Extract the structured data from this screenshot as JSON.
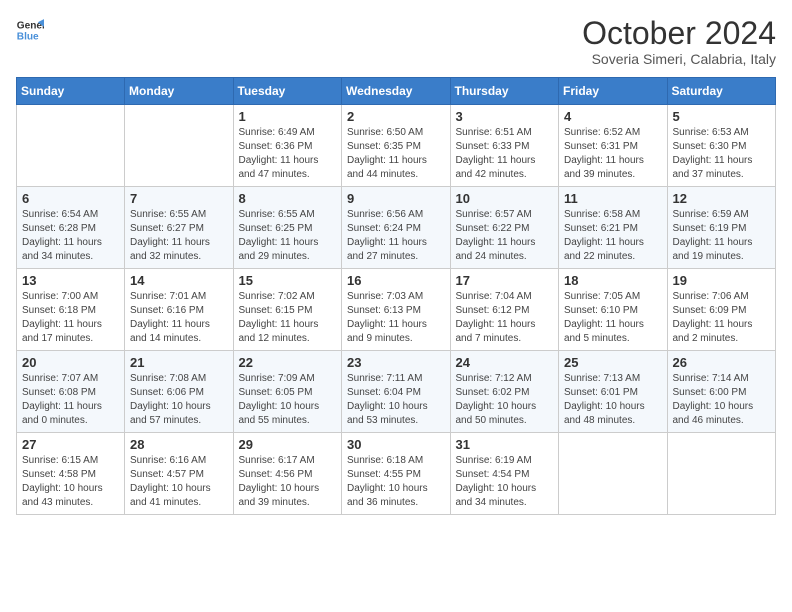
{
  "logo": {
    "line1": "General",
    "line2": "Blue"
  },
  "title": "October 2024",
  "location": "Soveria Simeri, Calabria, Italy",
  "days_header": [
    "Sunday",
    "Monday",
    "Tuesday",
    "Wednesday",
    "Thursday",
    "Friday",
    "Saturday"
  ],
  "weeks": [
    [
      {
        "day": "",
        "detail": ""
      },
      {
        "day": "",
        "detail": ""
      },
      {
        "day": "1",
        "detail": "Sunrise: 6:49 AM\nSunset: 6:36 PM\nDaylight: 11 hours and 47 minutes."
      },
      {
        "day": "2",
        "detail": "Sunrise: 6:50 AM\nSunset: 6:35 PM\nDaylight: 11 hours and 44 minutes."
      },
      {
        "day": "3",
        "detail": "Sunrise: 6:51 AM\nSunset: 6:33 PM\nDaylight: 11 hours and 42 minutes."
      },
      {
        "day": "4",
        "detail": "Sunrise: 6:52 AM\nSunset: 6:31 PM\nDaylight: 11 hours and 39 minutes."
      },
      {
        "day": "5",
        "detail": "Sunrise: 6:53 AM\nSunset: 6:30 PM\nDaylight: 11 hours and 37 minutes."
      }
    ],
    [
      {
        "day": "6",
        "detail": "Sunrise: 6:54 AM\nSunset: 6:28 PM\nDaylight: 11 hours and 34 minutes."
      },
      {
        "day": "7",
        "detail": "Sunrise: 6:55 AM\nSunset: 6:27 PM\nDaylight: 11 hours and 32 minutes."
      },
      {
        "day": "8",
        "detail": "Sunrise: 6:55 AM\nSunset: 6:25 PM\nDaylight: 11 hours and 29 minutes."
      },
      {
        "day": "9",
        "detail": "Sunrise: 6:56 AM\nSunset: 6:24 PM\nDaylight: 11 hours and 27 minutes."
      },
      {
        "day": "10",
        "detail": "Sunrise: 6:57 AM\nSunset: 6:22 PM\nDaylight: 11 hours and 24 minutes."
      },
      {
        "day": "11",
        "detail": "Sunrise: 6:58 AM\nSunset: 6:21 PM\nDaylight: 11 hours and 22 minutes."
      },
      {
        "day": "12",
        "detail": "Sunrise: 6:59 AM\nSunset: 6:19 PM\nDaylight: 11 hours and 19 minutes."
      }
    ],
    [
      {
        "day": "13",
        "detail": "Sunrise: 7:00 AM\nSunset: 6:18 PM\nDaylight: 11 hours and 17 minutes."
      },
      {
        "day": "14",
        "detail": "Sunrise: 7:01 AM\nSunset: 6:16 PM\nDaylight: 11 hours and 14 minutes."
      },
      {
        "day": "15",
        "detail": "Sunrise: 7:02 AM\nSunset: 6:15 PM\nDaylight: 11 hours and 12 minutes."
      },
      {
        "day": "16",
        "detail": "Sunrise: 7:03 AM\nSunset: 6:13 PM\nDaylight: 11 hours and 9 minutes."
      },
      {
        "day": "17",
        "detail": "Sunrise: 7:04 AM\nSunset: 6:12 PM\nDaylight: 11 hours and 7 minutes."
      },
      {
        "day": "18",
        "detail": "Sunrise: 7:05 AM\nSunset: 6:10 PM\nDaylight: 11 hours and 5 minutes."
      },
      {
        "day": "19",
        "detail": "Sunrise: 7:06 AM\nSunset: 6:09 PM\nDaylight: 11 hours and 2 minutes."
      }
    ],
    [
      {
        "day": "20",
        "detail": "Sunrise: 7:07 AM\nSunset: 6:08 PM\nDaylight: 11 hours and 0 minutes."
      },
      {
        "day": "21",
        "detail": "Sunrise: 7:08 AM\nSunset: 6:06 PM\nDaylight: 10 hours and 57 minutes."
      },
      {
        "day": "22",
        "detail": "Sunrise: 7:09 AM\nSunset: 6:05 PM\nDaylight: 10 hours and 55 minutes."
      },
      {
        "day": "23",
        "detail": "Sunrise: 7:11 AM\nSunset: 6:04 PM\nDaylight: 10 hours and 53 minutes."
      },
      {
        "day": "24",
        "detail": "Sunrise: 7:12 AM\nSunset: 6:02 PM\nDaylight: 10 hours and 50 minutes."
      },
      {
        "day": "25",
        "detail": "Sunrise: 7:13 AM\nSunset: 6:01 PM\nDaylight: 10 hours and 48 minutes."
      },
      {
        "day": "26",
        "detail": "Sunrise: 7:14 AM\nSunset: 6:00 PM\nDaylight: 10 hours and 46 minutes."
      }
    ],
    [
      {
        "day": "27",
        "detail": "Sunrise: 6:15 AM\nSunset: 4:58 PM\nDaylight: 10 hours and 43 minutes."
      },
      {
        "day": "28",
        "detail": "Sunrise: 6:16 AM\nSunset: 4:57 PM\nDaylight: 10 hours and 41 minutes."
      },
      {
        "day": "29",
        "detail": "Sunrise: 6:17 AM\nSunset: 4:56 PM\nDaylight: 10 hours and 39 minutes."
      },
      {
        "day": "30",
        "detail": "Sunrise: 6:18 AM\nSunset: 4:55 PM\nDaylight: 10 hours and 36 minutes."
      },
      {
        "day": "31",
        "detail": "Sunrise: 6:19 AM\nSunset: 4:54 PM\nDaylight: 10 hours and 34 minutes."
      },
      {
        "day": "",
        "detail": ""
      },
      {
        "day": "",
        "detail": ""
      }
    ]
  ]
}
